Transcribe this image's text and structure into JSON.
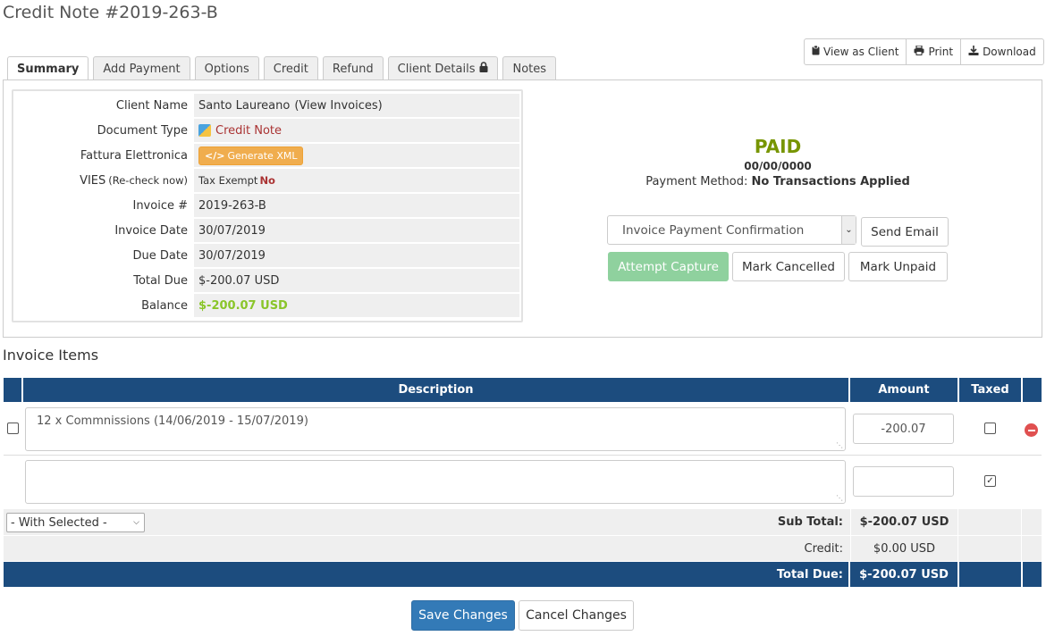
{
  "page": {
    "title": "Credit Note #2019-263-B"
  },
  "toolbar": {
    "view_as_client": "View as Client",
    "print": "Print",
    "download": "Download"
  },
  "tabs": [
    {
      "label": "Summary",
      "active": true
    },
    {
      "label": "Add Payment"
    },
    {
      "label": "Options"
    },
    {
      "label": "Credit"
    },
    {
      "label": "Refund"
    },
    {
      "label": "Client Details",
      "icon": "lock-icon"
    },
    {
      "label": "Notes"
    }
  ],
  "summary": {
    "client_name_label": "Client Name",
    "client_name": "Santo Laureano",
    "view_invoices": "(View Invoices)",
    "document_type_label": "Document Type",
    "document_type": "Credit Note",
    "fattura_label": "Fattura Elettronica",
    "generate_xml": "Generate XML",
    "vies_label": "VIES",
    "recheck": "(Re-check now)",
    "tax_exempt_label": "Tax Exempt",
    "tax_exempt_value": "No",
    "invoice_num_label": "Invoice #",
    "invoice_num": "2019-263-B",
    "invoice_date_label": "Invoice Date",
    "invoice_date": "30/07/2019",
    "due_date_label": "Due Date",
    "due_date": "30/07/2019",
    "total_due_label": "Total Due",
    "total_due": "$-200.07 USD",
    "balance_label": "Balance",
    "balance": "$-200.07 USD"
  },
  "status": {
    "state": "PAID",
    "date": "00/00/0000",
    "payment_method_label": "Payment Method:",
    "payment_method": "No Transactions Applied",
    "email_template": "Invoice Payment Confirmation",
    "send_email": "Send Email",
    "attempt_capture": "Attempt Capture",
    "mark_cancelled": "Mark Cancelled",
    "mark_unpaid": "Mark Unpaid"
  },
  "items": {
    "section_title": "Invoice Items",
    "headers": {
      "description": "Description",
      "amount": "Amount",
      "taxed": "Taxed"
    },
    "rows": [
      {
        "description": "12 x Commnissions (14/06/2019 - 15/07/2019)",
        "amount": "-200.07",
        "taxed": false
      },
      {
        "description": "",
        "amount": "",
        "taxed": true
      }
    ],
    "with_selected": "- With Selected -",
    "subtotal_label": "Sub Total:",
    "subtotal": "$-200.07 USD",
    "credit_label": "Credit:",
    "credit": "$0.00 USD",
    "total_due_label": "Total Due:",
    "total_due": "$-200.07 USD"
  },
  "actions": {
    "save": "Save Changes",
    "cancel": "Cancel Changes"
  },
  "colors": {
    "header_blue": "#1c4c7e",
    "paid_green": "#779500",
    "balance_green": "#8ac52a",
    "primary": "#337ab7"
  }
}
